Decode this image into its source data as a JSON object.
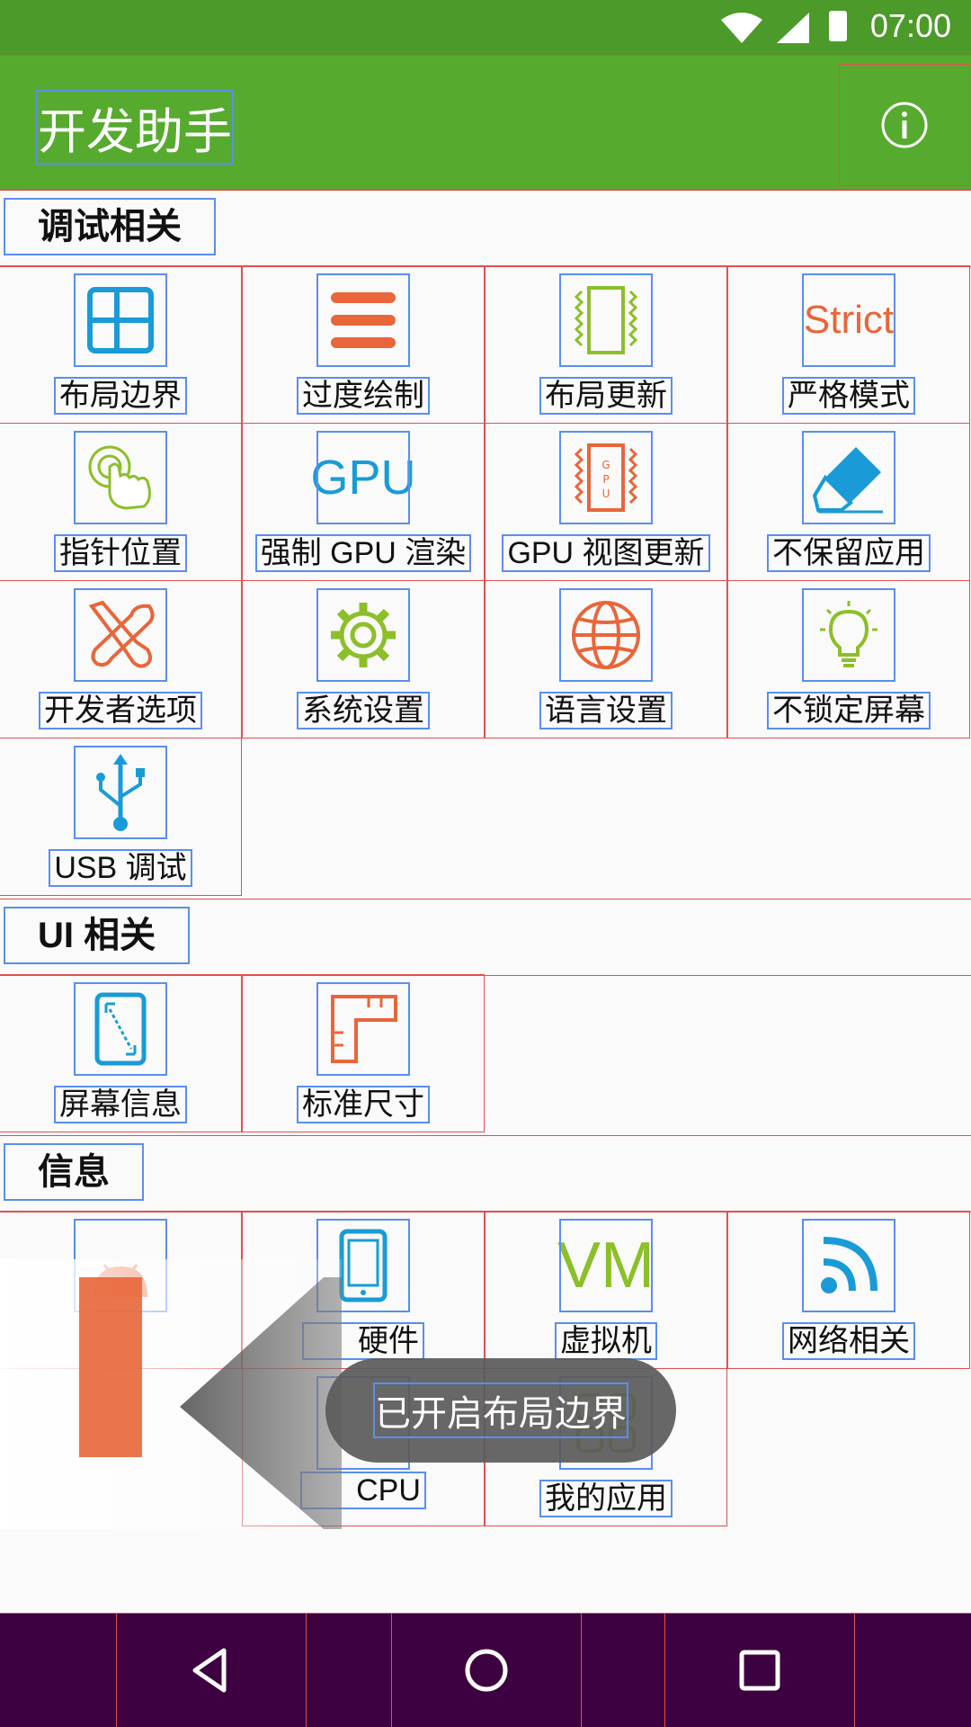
{
  "status": {
    "time": "07:00"
  },
  "appbar": {
    "title": "开发助手",
    "info_icon": "info-icon"
  },
  "sections": [
    {
      "title": "调试相关",
      "items": [
        {
          "label": "布局边界",
          "icon": "layout-grid-icon",
          "color": "#1a9bd7"
        },
        {
          "label": "过度绘制",
          "icon": "menu-lines-icon",
          "color": "#e8663a"
        },
        {
          "label": "布局更新",
          "icon": "chip-outline-icon",
          "color": "#8cbf2a"
        },
        {
          "label": "严格模式",
          "icon": "strict-text-icon",
          "color": "#e8663a",
          "icon_text": "Strict"
        },
        {
          "label": "指针位置",
          "icon": "hand-pointer-icon",
          "color": "#8cbf2a"
        },
        {
          "label": "强制 GPU 渲染",
          "icon": "gpu-text-icon",
          "color": "#1a9bd7",
          "icon_text": "GPU"
        },
        {
          "label": "GPU 视图更新",
          "icon": "gpu-chip-icon",
          "color": "#e8663a"
        },
        {
          "label": "不保留应用",
          "icon": "eraser-icon",
          "color": "#1a9bd7"
        },
        {
          "label": "开发者选项",
          "icon": "tools-icon",
          "color": "#e8663a"
        },
        {
          "label": "系统设置",
          "icon": "gear-icon",
          "color": "#8cbf2a"
        },
        {
          "label": "语言设置",
          "icon": "globe-icon",
          "color": "#e8663a"
        },
        {
          "label": "不锁定屏幕",
          "icon": "lightbulb-icon",
          "color": "#8cbf2a"
        },
        {
          "label": "USB 调试",
          "icon": "usb-icon",
          "color": "#1a9bd7"
        }
      ]
    },
    {
      "title": "UI 相关",
      "items": [
        {
          "label": "屏幕信息",
          "icon": "phone-screen-icon",
          "color": "#1a9bd7"
        },
        {
          "label": "标准尺寸",
          "icon": "ruler-icon",
          "color": "#e8663a"
        }
      ]
    },
    {
      "title": "信息",
      "items": [
        {
          "label": "",
          "icon": "android-icon",
          "color": "#e8663a"
        },
        {
          "label": "硬件",
          "icon": "phone-icon",
          "color": "#1a9bd7"
        },
        {
          "label": "虚拟机",
          "icon": "vm-text-icon",
          "color": "#8cbf2a",
          "icon_text": "VM"
        },
        {
          "label": "网络相关",
          "icon": "rss-icon",
          "color": "#1a9bd7"
        },
        {
          "label": "CPU",
          "icon": "cpu-icon",
          "color": "#1a9bd7"
        },
        {
          "label": "我的应用",
          "icon": "apps-icon",
          "color": "#8cbf2a"
        }
      ]
    }
  ],
  "toast": "已开启布局边界",
  "navbar": {
    "back": "back-icon",
    "home": "home-icon",
    "recents": "recents-icon"
  }
}
